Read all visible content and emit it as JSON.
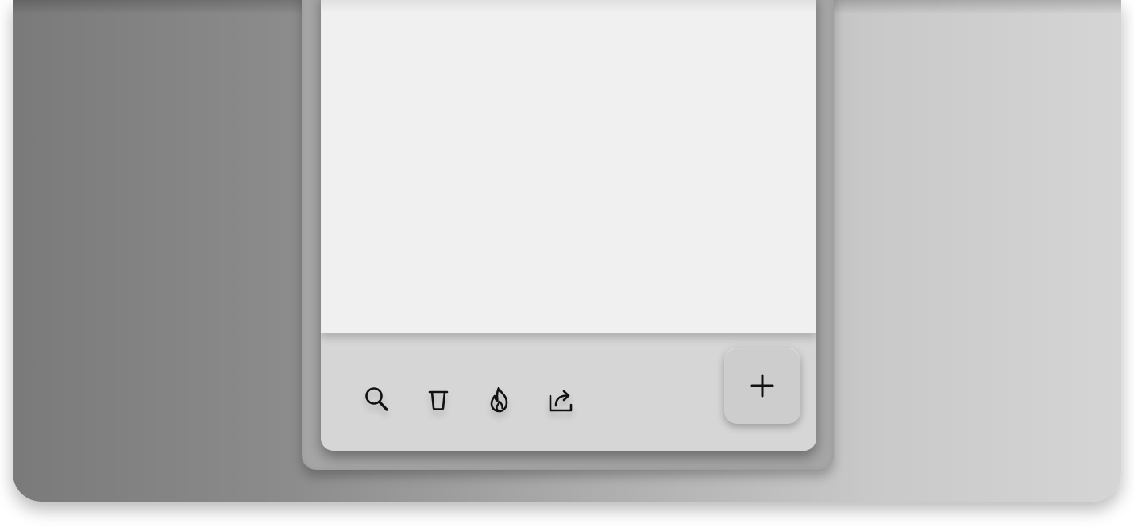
{
  "app": {
    "background_gradient": [
      "#7a7a7a",
      "#d5d5d5"
    ],
    "content_bg": "#f0f0f0",
    "toolbar_bg": "#d6d6d6"
  },
  "toolbar": {
    "actions": [
      {
        "name": "search",
        "icon": "search-icon"
      },
      {
        "name": "delete",
        "icon": "trash-icon"
      },
      {
        "name": "hot",
        "icon": "flame-icon"
      },
      {
        "name": "share",
        "icon": "share-icon"
      }
    ],
    "add_button": {
      "icon": "plus-icon",
      "label": "+"
    }
  }
}
